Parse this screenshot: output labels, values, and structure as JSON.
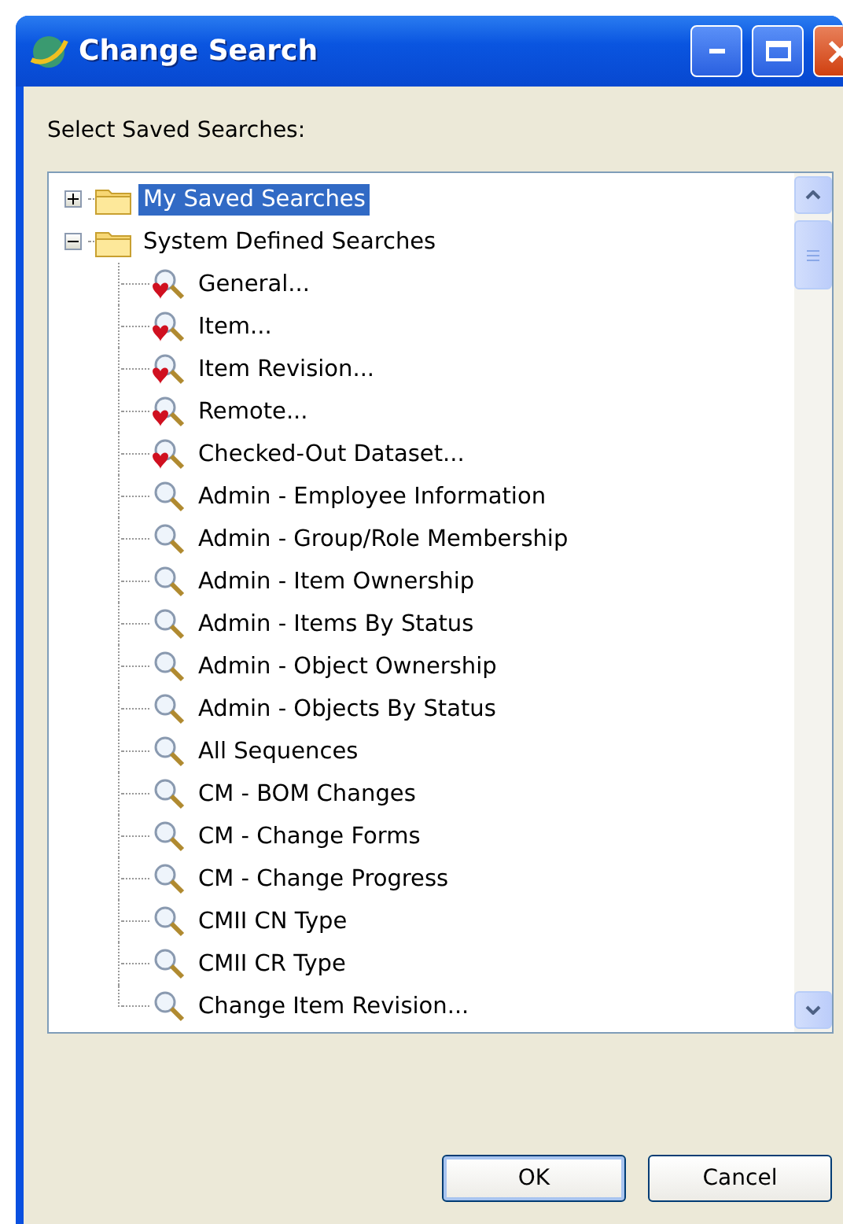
{
  "window": {
    "title": "Change Search"
  },
  "prompt": "Select Saved Searches:",
  "tree": [
    {
      "label": "My Saved Searches",
      "expanded": false,
      "selected": true
    },
    {
      "label": "System Defined Searches",
      "expanded": true,
      "selected": false,
      "children": [
        {
          "label": "General...",
          "kind": "favorite",
          "selected": false
        },
        {
          "label": "Item...",
          "kind": "favorite",
          "selected": false
        },
        {
          "label": "Item Revision...",
          "kind": "favorite",
          "selected": false
        },
        {
          "label": "Remote...",
          "kind": "favorite",
          "selected": false
        },
        {
          "label": "Checked-Out Dataset...",
          "kind": "favorite",
          "selected": false
        },
        {
          "label": "Admin - Employee Information",
          "kind": "query",
          "selected": false
        },
        {
          "label": "Admin - Group/Role Membership",
          "kind": "query",
          "selected": false
        },
        {
          "label": "Admin - Item Ownership",
          "kind": "query",
          "selected": false
        },
        {
          "label": "Admin - Items By Status",
          "kind": "query",
          "selected": false
        },
        {
          "label": "Admin - Object Ownership",
          "kind": "query",
          "selected": false
        },
        {
          "label": "Admin - Objects By Status",
          "kind": "query",
          "selected": false
        },
        {
          "label": "All Sequences",
          "kind": "query",
          "selected": false
        },
        {
          "label": "CM - BOM Changes",
          "kind": "query",
          "selected": false
        },
        {
          "label": "CM - Change Forms",
          "kind": "query",
          "selected": false
        },
        {
          "label": "CM - Change Progress",
          "kind": "query",
          "selected": false
        },
        {
          "label": "CMII CN Type",
          "kind": "query",
          "selected": false
        },
        {
          "label": "CMII CR Type",
          "kind": "query",
          "selected": false
        },
        {
          "label": "Change Item Revision...",
          "kind": "query",
          "selected": false
        }
      ]
    }
  ],
  "buttons": [
    {
      "label": "OK",
      "default": true
    },
    {
      "label": "Cancel",
      "default": false
    }
  ]
}
